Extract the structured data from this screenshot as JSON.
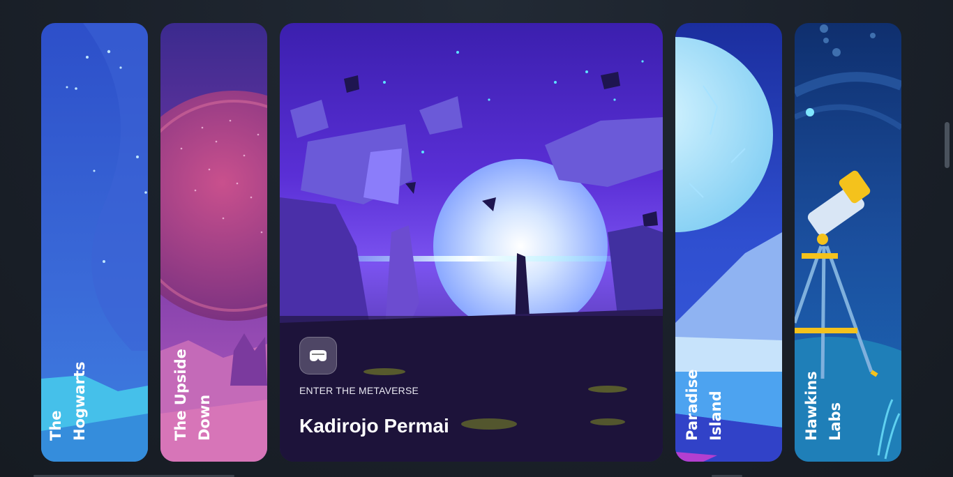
{
  "cards": [
    {
      "line1": "The",
      "line2": "Hogwarts",
      "active": false
    },
    {
      "line1": "The Upside",
      "line2": "Down",
      "active": false
    },
    {
      "eyebrow": "ENTER THE METAVERSE",
      "title": "Kadirojo Permai",
      "icon": "vr-headset-icon",
      "active": true
    },
    {
      "line1": "Paradise",
      "line2": "Island",
      "active": false
    },
    {
      "line1": "Hawkins",
      "line2": "Labs",
      "active": false
    }
  ],
  "colors": {
    "background": "#1b222b",
    "accent": "#6a35e0",
    "text": "#ffffff"
  }
}
